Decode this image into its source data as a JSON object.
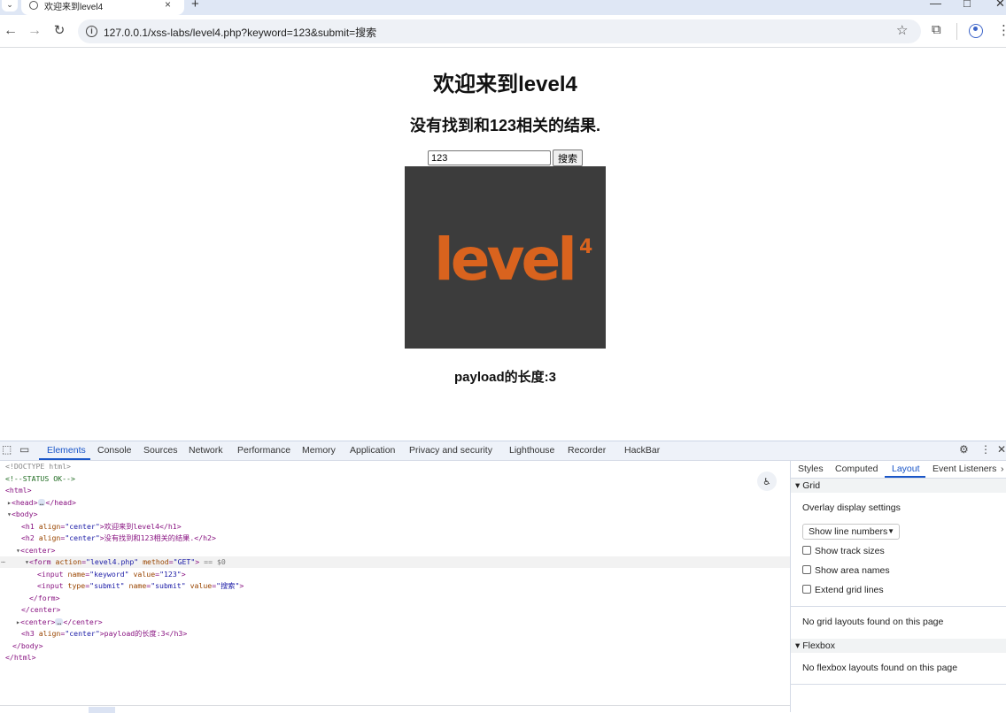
{
  "browser": {
    "tab_title": "欢迎来到level4",
    "tab_close": "×",
    "new_tab": "+",
    "url": "127.0.0.1/xss-labs/level4.php?keyword=123&submit=搜索",
    "site_info_glyph": "i",
    "window_minimize": "—",
    "window_maximize": "□",
    "window_close": "✕"
  },
  "page": {
    "title": "欢迎来到level4",
    "result_message": "没有找到和123相关的结果.",
    "keyword_value": "123",
    "submit_label": "搜索",
    "logo_text": "level",
    "logo_superscript": "4",
    "payload_length": "payload的长度:3"
  },
  "devtools": {
    "tabs": [
      "Elements",
      "Console",
      "Sources",
      "Network",
      "Performance",
      "Memory",
      "Application",
      "Privacy and security",
      "Lighthouse",
      "Recorder",
      "HackBar"
    ],
    "dom": {
      "doctype": "<!DOCTYPE html>",
      "comment": "<!--STATUS OK-->",
      "html_open": "<html>",
      "head": [
        "<head>",
        "</head>"
      ],
      "body_open": "<body>",
      "h1": {
        "open": "<h1 ",
        "attr_name": "align",
        "attr_value": "\"center\"",
        "text": ">欢迎来到level4</h1>"
      },
      "h2": {
        "open": "<h2 ",
        "attr_name": "align",
        "attr_value": "\"center\"",
        "text": ">没有找到和123相关的结果.</h2>"
      },
      "center_open": "<center>",
      "form": {
        "open": "<form ",
        "action_name": "action",
        "action_value": "\"level4.php\"",
        "method_name": "method",
        "method_value": "\"GET\"",
        "close_bracket": ">",
        "eq_marker": "== $0"
      },
      "input1": {
        "open": "<input ",
        "name_attr": "name",
        "name_value": "\"keyword\"",
        "value_attr": "value",
        "value_value": "\"123\"",
        "close": ">"
      },
      "input2": {
        "open": "<input ",
        "type_attr": "type",
        "type_value": "\"submit\"",
        "name_attr": "name",
        "name_value": "\"submit\"",
        "value_attr": "value",
        "value_value": "\"搜索\"",
        "close": ">"
      },
      "form_close": "</form>",
      "center_close": "</center>",
      "center2": [
        "<center>",
        "</center>"
      ],
      "h3": {
        "open": "<h3 ",
        "attr_name": "align",
        "attr_value": "\"center\"",
        "text": ">payload的长度:3</h3>"
      },
      "body_close": "</body>",
      "html_close": "</html>"
    },
    "sidebar": {
      "tabs": [
        "Styles",
        "Computed",
        "Layout",
        "Event Listeners"
      ],
      "grid_section": "Grid",
      "overlay_settings": "Overlay display settings",
      "line_numbers_select": "Show line numbers",
      "checkboxes": [
        "Show track sizes",
        "Show area names",
        "Extend grid lines"
      ],
      "no_grid": "No grid layouts found on this page",
      "flexbox_section": "Flexbox",
      "no_flexbox": "No flexbox layouts found on this page"
    }
  },
  "colors": {
    "logo_background": "#3c3c3c",
    "logo_orange": "#d9631e",
    "devtools_accent": "#1a56c8"
  }
}
